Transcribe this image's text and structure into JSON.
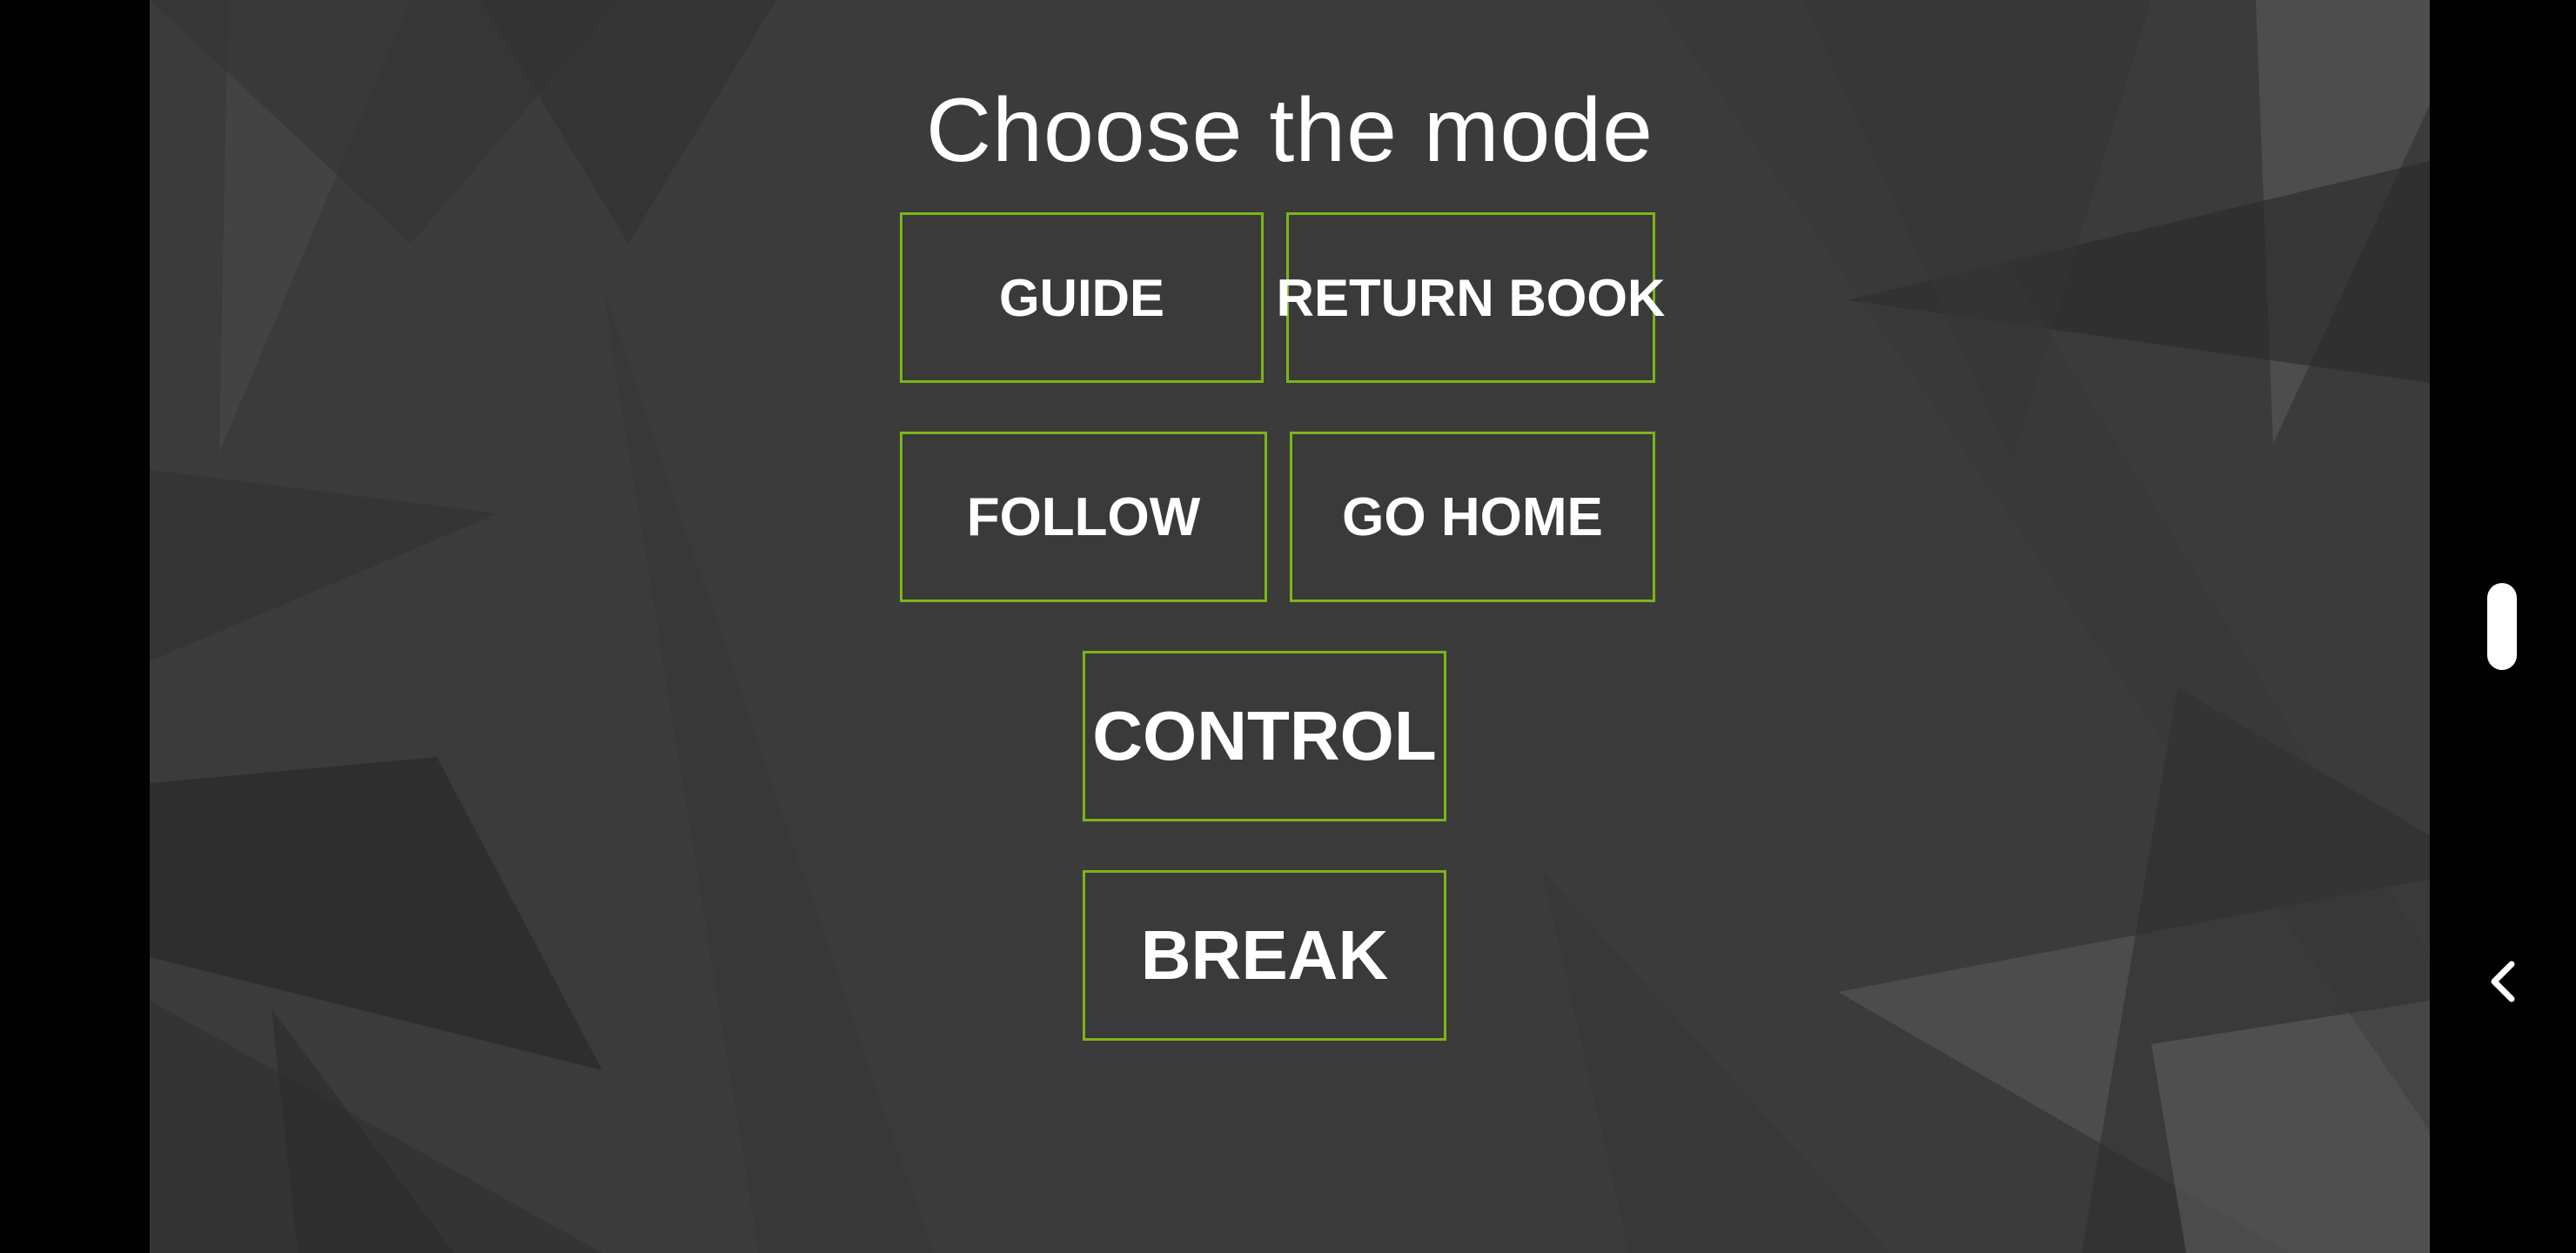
{
  "screen": {
    "title": "Choose the mode",
    "buttons": {
      "guide": "GUIDE",
      "return_book": "RETURN BOOK",
      "follow": "FOLLOW",
      "go_home": "GO HOME",
      "control": "CONTROL",
      "break": "BREAK"
    }
  },
  "colors": {
    "background": "#3b3b3b",
    "letterbox": "#000000",
    "button_border": "#7cb518",
    "text": "#ffffff"
  },
  "icons": {
    "side_handle": "scroll-handle-icon",
    "back": "chevron-left-icon"
  }
}
